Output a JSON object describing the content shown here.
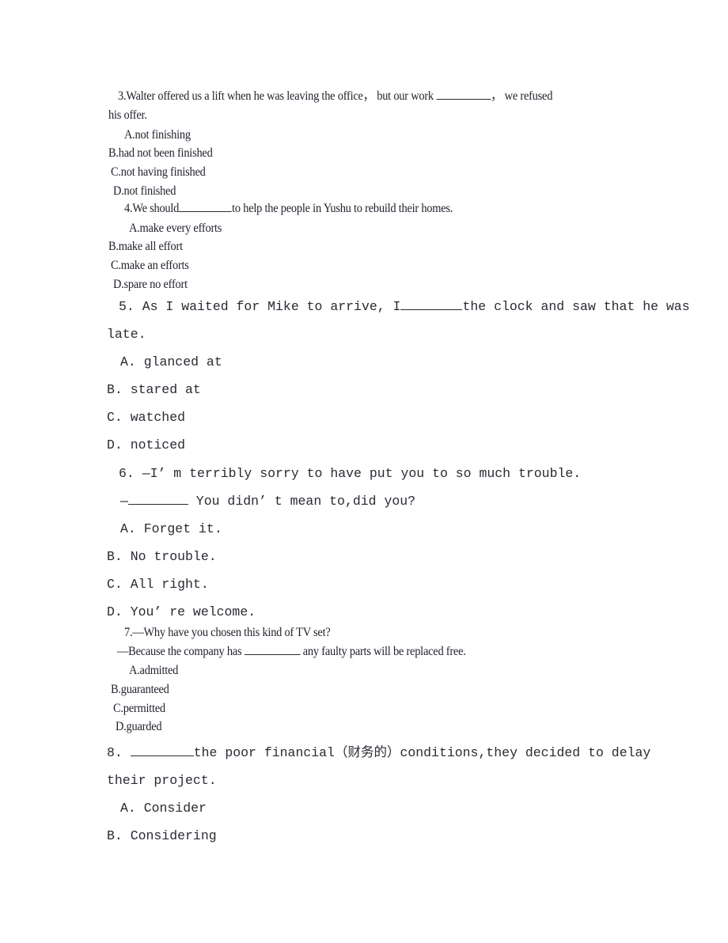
{
  "document": {
    "type": "english-grammar-multiple-choice-worksheet",
    "page_background": "#ffffff",
    "text_color": "#22222e"
  },
  "questions": [
    {
      "number": "3.",
      "stem_line1_before": "3.Walter offered us a lift when he was leaving the office， but our work ",
      "stem_line1_after": "， we refused",
      "stem_line2": "his offer.",
      "options": [
        "A.not finishing",
        "B.had not been finished",
        "C.not having finished",
        "D.not finished"
      ]
    },
    {
      "number": "4.",
      "stem_before": "4.We should",
      "stem_after": "to help the people in Yushu to rebuild their homes.",
      "options": [
        "A.make every efforts",
        "B.make all effort",
        "C.make an efforts",
        "D.spare no effort"
      ]
    },
    {
      "number": "5.",
      "stem_line1_before": "5. As I waited for Mike to arrive, I",
      "stem_line1_after": "the clock and saw that he was",
      "stem_line2": "late.",
      "options": [
        "A. glanced at",
        "B. stared at",
        "C. watched",
        "D. noticed"
      ]
    },
    {
      "number": "6.",
      "stem_line1": "6. —I’ m terribly sorry to have put you to so much trouble.",
      "stem_line2_before": "—",
      "stem_line2_after": " You didn’ t mean to,did you?",
      "options": [
        "A. Forget it.",
        "B. No trouble.",
        "C. All right.",
        "D. You’ re welcome."
      ]
    },
    {
      "number": "7.",
      "stem_line1": "7.—Why have you chosen this kind of TV set?",
      "stem_line2_before": "—Because the company has ",
      "stem_line2_after": " any faulty parts will be replaced free.",
      "options": [
        "A.admitted",
        "B.guaranteed",
        "C.permitted",
        "D.guarded"
      ]
    },
    {
      "number": "8.",
      "stem_line1_before": "8. ",
      "stem_line1_after": "the poor financial（财务的）conditions,they decided to delay",
      "stem_line2": "their project.",
      "options": [
        "A. Consider",
        "B. Considering"
      ]
    }
  ]
}
